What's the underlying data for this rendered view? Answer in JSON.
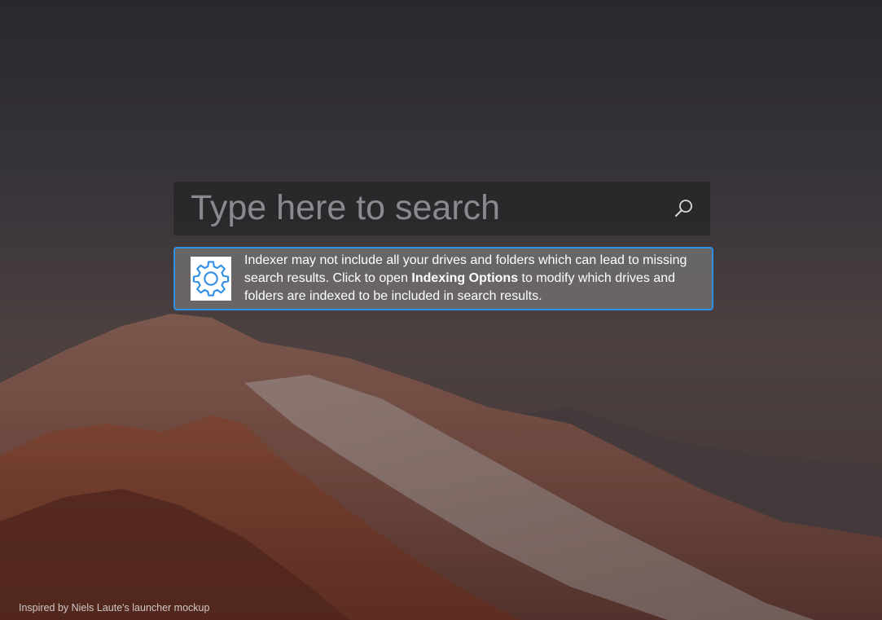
{
  "search": {
    "placeholder": "Type here to search",
    "icon": "search-icon"
  },
  "notice": {
    "icon": "gear-icon",
    "text_before": "Indexer may not include all your drives and folders which can lead to missing search results. Click to open ",
    "link_text": "Indexing Options",
    "text_after": " to modify which drives and folders are indexed to be included in search results.",
    "border_color": "#2f8fe6",
    "icon_color": "#2f8fe6"
  },
  "footer": {
    "credit": "Inspired by Niels Laute's launcher mockup"
  }
}
